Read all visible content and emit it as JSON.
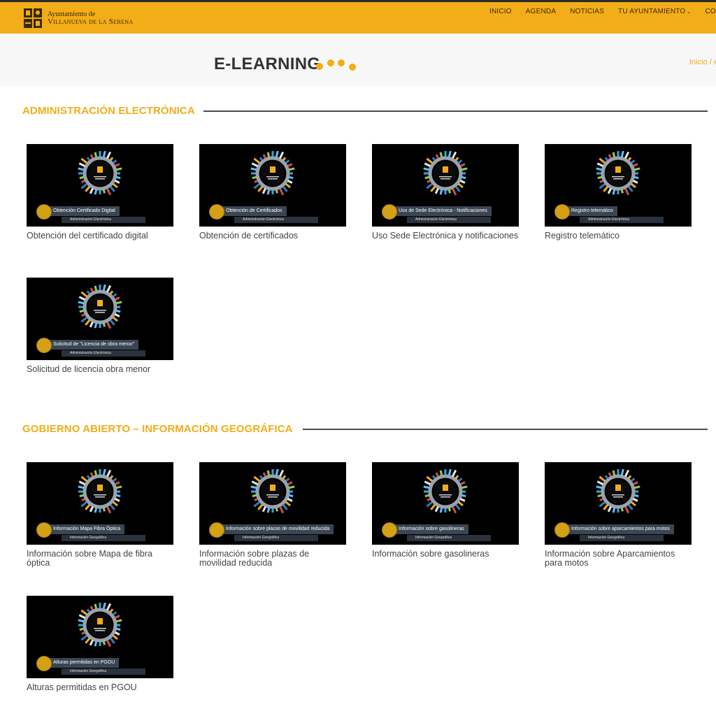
{
  "header": {
    "logo_line1": "Ayuntamiento de",
    "logo_line2": "Villanueva de la Serena",
    "nav": [
      "INICIO",
      "AGENDA",
      "NOTICIAS",
      "TU AYUNTAMIENTO",
      "CONCE"
    ]
  },
  "page": {
    "title": "E-LEARNING",
    "breadcrumb_home": "Inicio",
    "breadcrumb_rest": "/ e"
  },
  "sections": [
    {
      "title": "ADMINISTRACIÓN ELECTRÓNICA",
      "videos": [
        {
          "caption": "Obtención Certificado Digital",
          "subcaption": "Administración Electrónica",
          "title": "Obtención del certificado digital"
        },
        {
          "caption": "Obtención de Certificados",
          "subcaption": "Administración Electrónica",
          "title": "Obtención de certificados"
        },
        {
          "caption": "Uso de Sede Electrónica - Notificaciones",
          "subcaption": "Administración Electrónica",
          "title": "Uso Sede Electrónica y notificaciones"
        },
        {
          "caption": "Registro telemático",
          "subcaption": "Administración Electrónica",
          "title": "Registro telemático"
        },
        {
          "caption": "Solicitud de \"Licencia de obra menor\"",
          "subcaption": "Administración Electrónica",
          "title": "Solicitud de licencia obra menor"
        }
      ]
    },
    {
      "title": "GOBIERNO ABIERTO – INFORMACIÓN GEOGRÁFICA",
      "videos": [
        {
          "caption": "Información Mapa Fibra Óptica",
          "subcaption": "Información Geográfica",
          "title": "Información sobre Mapa de fibra óptica"
        },
        {
          "caption": "Información sobre plazas de movilidad reducida",
          "subcaption": "Información Geográfica",
          "title": "Información sobre plazas de movilidad reducida"
        },
        {
          "caption": "Información sobre gasolineras",
          "subcaption": "Información Geográfica",
          "title": "Información sobre gasolineras"
        },
        {
          "caption": "Información sobre aparcamientos para motos",
          "subcaption": "Información Geográfica",
          "title": "Información sobre Aparcamientos para motos"
        },
        {
          "caption": "Alturas permitidas en PGOU",
          "subcaption": "Información Geográfica",
          "title": "Alturas permitidas en PGOU"
        }
      ]
    }
  ],
  "colors": {
    "accent": "#f2ad18",
    "text": "#444444",
    "thumb_bg": "#000000"
  }
}
